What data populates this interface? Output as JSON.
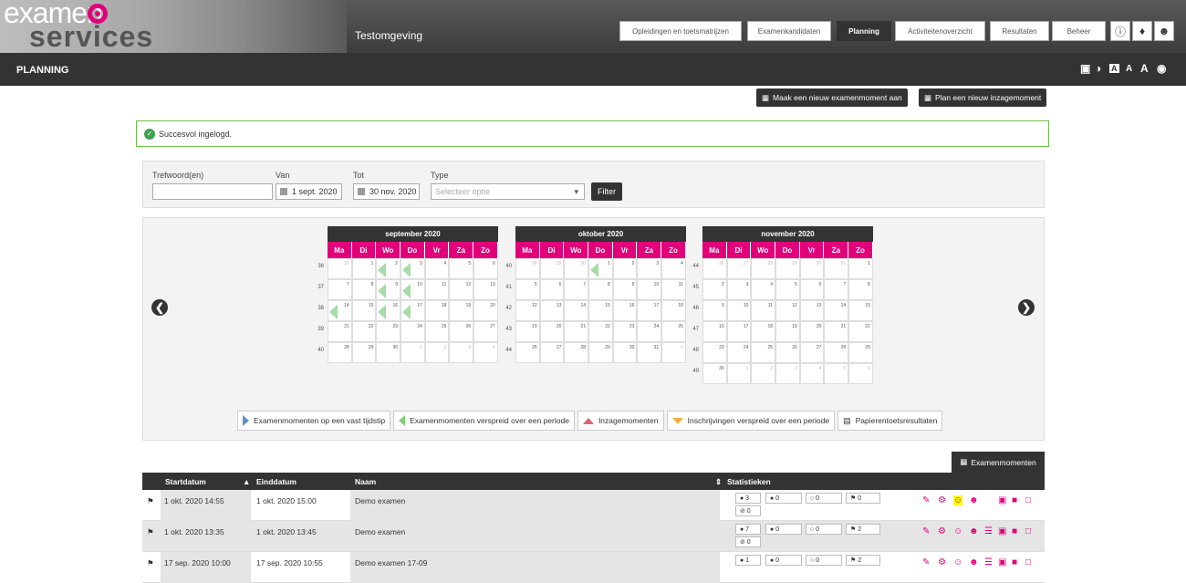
{
  "header": {
    "logo_line1": "examen",
    "logo_line2": "services",
    "environment": "Testomgeving",
    "nav": [
      {
        "label": "Opleidingen en toetsmatrijzen"
      },
      {
        "label": "Examenkandidaten"
      },
      {
        "label": "Planning"
      },
      {
        "label": "Activiteitenoverzicht"
      },
      {
        "label": "Resultaten"
      },
      {
        "label": "Beheer"
      }
    ],
    "icons": [
      "info-icon",
      "bell-icon",
      "user-icon"
    ]
  },
  "pagebar": {
    "title": "PLANNING",
    "tools": [
      "monitor-icon",
      "contrast-icon",
      "font-small-icon",
      "font-medium-icon",
      "font-large-icon",
      "globe-icon"
    ],
    "font_labels": [
      "A",
      "A",
      "A"
    ]
  },
  "actions": {
    "new_exam": "Maak een nieuw examenmoment aan",
    "new_review": "Plan een nieuw inzagemoment"
  },
  "alert": {
    "text": "Succesvol ingelogd."
  },
  "filter": {
    "keyword_label": "Trefwoord(en)",
    "from_label": "Van",
    "from_value": "1 sept. 2020",
    "to_label": "Tot",
    "to_value": "30 nov. 2020",
    "type_label": "Type",
    "type_placeholder": "Selecteer optie",
    "button": "Filter"
  },
  "calendar": {
    "day_headers": [
      "Ma",
      "Di",
      "Wo",
      "Do",
      "Vr",
      "Za",
      "Zo"
    ],
    "months": [
      {
        "title": "september 2020",
        "weeks": [
          36,
          37,
          38,
          39,
          40
        ],
        "days": [
          [
            31,
            1,
            2,
            3,
            4,
            5,
            6
          ],
          [
            7,
            8,
            9,
            10,
            11,
            12,
            13
          ],
          [
            14,
            15,
            16,
            17,
            18,
            19,
            20
          ],
          [
            21,
            22,
            23,
            24,
            25,
            26,
            27
          ],
          [
            28,
            29,
            30,
            1,
            2,
            3,
            4
          ]
        ],
        "other_month": [
          [
            1,
            0,
            0,
            0,
            0,
            0,
            0
          ],
          [
            0,
            0,
            0,
            0,
            0,
            0,
            0
          ],
          [
            0,
            0,
            0,
            0,
            0,
            0,
            0
          ],
          [
            0,
            0,
            0,
            0,
            0,
            0,
            0
          ],
          [
            0,
            0,
            0,
            1,
            1,
            1,
            1
          ]
        ],
        "marks": [
          [
            0,
            0,
            1,
            1,
            0,
            0,
            0
          ],
          [
            0,
            0,
            1,
            1,
            0,
            0,
            0
          ],
          [
            1,
            0,
            1,
            1,
            0,
            0,
            0
          ],
          [
            0,
            0,
            0,
            0,
            0,
            0,
            0
          ],
          [
            0,
            0,
            0,
            0,
            0,
            0,
            0
          ]
        ]
      },
      {
        "title": "oktober 2020",
        "weeks": [
          40,
          41,
          42,
          43,
          44
        ],
        "days": [
          [
            28,
            29,
            30,
            1,
            2,
            3,
            4
          ],
          [
            5,
            6,
            7,
            8,
            9,
            10,
            11
          ],
          [
            12,
            13,
            14,
            15,
            16,
            17,
            18
          ],
          [
            19,
            20,
            21,
            22,
            23,
            24,
            25
          ],
          [
            26,
            27,
            28,
            29,
            30,
            31,
            1
          ]
        ],
        "other_month": [
          [
            1,
            1,
            1,
            0,
            0,
            0,
            0
          ],
          [
            0,
            0,
            0,
            0,
            0,
            0,
            0
          ],
          [
            0,
            0,
            0,
            0,
            0,
            0,
            0
          ],
          [
            0,
            0,
            0,
            0,
            0,
            0,
            0
          ],
          [
            0,
            0,
            0,
            0,
            0,
            0,
            1
          ]
        ],
        "marks": [
          [
            0,
            0,
            0,
            1,
            0,
            0,
            0
          ],
          [
            0,
            0,
            0,
            0,
            0,
            0,
            0
          ],
          [
            0,
            0,
            0,
            0,
            0,
            0,
            0
          ],
          [
            0,
            0,
            0,
            0,
            0,
            0,
            0
          ],
          [
            0,
            0,
            0,
            0,
            0,
            0,
            0
          ]
        ]
      },
      {
        "title": "november 2020",
        "weeks": [
          44,
          45,
          46,
          47,
          48,
          49
        ],
        "days": [
          [
            26,
            27,
            28,
            29,
            30,
            31,
            1
          ],
          [
            2,
            3,
            4,
            5,
            6,
            7,
            8
          ],
          [
            9,
            10,
            11,
            12,
            13,
            14,
            15
          ],
          [
            16,
            17,
            18,
            19,
            20,
            21,
            22
          ],
          [
            23,
            24,
            25,
            26,
            27,
            28,
            29
          ],
          [
            30,
            1,
            2,
            3,
            4,
            5,
            6
          ]
        ],
        "other_month": [
          [
            1,
            1,
            1,
            1,
            1,
            1,
            0
          ],
          [
            0,
            0,
            0,
            0,
            0,
            0,
            0
          ],
          [
            0,
            0,
            0,
            0,
            0,
            0,
            0
          ],
          [
            0,
            0,
            0,
            0,
            0,
            0,
            0
          ],
          [
            0,
            0,
            0,
            0,
            0,
            0,
            0
          ],
          [
            0,
            1,
            1,
            1,
            1,
            1,
            1
          ]
        ],
        "marks": [
          [
            0,
            0,
            0,
            0,
            0,
            0,
            0
          ],
          [
            0,
            0,
            0,
            0,
            0,
            0,
            0
          ],
          [
            0,
            0,
            0,
            0,
            0,
            0,
            0
          ],
          [
            0,
            0,
            0,
            0,
            0,
            0,
            0
          ],
          [
            0,
            0,
            0,
            0,
            0,
            0,
            0
          ],
          [
            0,
            0,
            0,
            0,
            0,
            0,
            0
          ]
        ]
      }
    ]
  },
  "legend": [
    {
      "label": "Examenmomenten op een vast tijdstip",
      "color": "#5b8fd0"
    },
    {
      "label": "Examenmomenten verspreid over een periode",
      "color": "#7ccd7c"
    },
    {
      "label": "Inzagemomenten",
      "color": "#e06070"
    },
    {
      "label": "Inschrijvingen verspreid over een periode",
      "color": "#f5b041"
    },
    {
      "label": "Papierentoetsresultaten",
      "color": "#333333"
    }
  ],
  "table": {
    "tab_label": "Examenmomenten",
    "columns": [
      "Startdatum",
      "Einddatum",
      "Naam",
      "Statistieken"
    ],
    "rows": [
      {
        "start": "1 okt. 2020 14:55",
        "end": "1 okt. 2020 15:00",
        "name": "Demo examen",
        "stats": [
          "3",
          "0",
          "0",
          "0",
          "0"
        ]
      },
      {
        "start": "1 okt. 2020 13:35",
        "end": "1 okt. 2020 13:45",
        "name": "Demo examen",
        "stats": [
          "7",
          "0",
          "0",
          "2",
          "0"
        ]
      },
      {
        "start": "17 sep. 2020 10:00",
        "end": "17 sep. 2020 10:55",
        "name": "Demo examen 17-09",
        "stats": [
          "1",
          "0",
          "0",
          "2",
          ""
        ]
      }
    ]
  },
  "colors": {
    "accent": "#e2007a",
    "dark": "#333333",
    "success": "#6cbf4a"
  }
}
